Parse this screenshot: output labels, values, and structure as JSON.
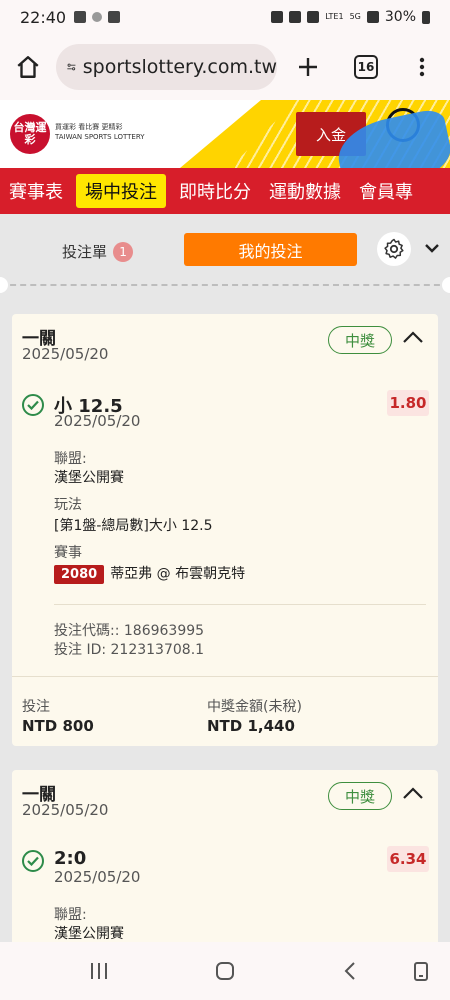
{
  "status_bar": {
    "time": "22:40",
    "network": "LTE1",
    "network_type": "5G",
    "battery": "30%"
  },
  "browser": {
    "url": "sportslottery.com.tw",
    "tab_count": "16"
  },
  "site": {
    "logo_text": "台灣運彩",
    "logo_sub_line1": "買運彩 看比賽 更精彩",
    "logo_sub_line2": "TAIWAN SPORTS LOTTERY",
    "deposit_label": "入金"
  },
  "nav": {
    "items": [
      "賽事表",
      "場中投注",
      "即時比分",
      "運動數據",
      "會員專"
    ],
    "active_index": 1
  },
  "betslip": {
    "slip_label": "投注單",
    "slip_count": "1",
    "my_bets_label": "我的投注"
  },
  "cards": [
    {
      "title": "一關",
      "date": "2025/05/20",
      "status": "中獎",
      "selection": "小 12.5",
      "selection_date": "2025/05/20",
      "odds": "1.80",
      "league_label": "聯盟:",
      "league": "漢堡公開賽",
      "market_label": "玩法",
      "market": "[第1盤-總局數]大小 12.5",
      "event_label": "賽事",
      "event_code": "2080",
      "event": "蒂亞弗 @ 布雲朝克特",
      "bet_code": "投注代碼:: 186963995",
      "bet_id": "投注 ID: 212313708.1",
      "stake_label": "投注",
      "stake": "NTD 800",
      "payout_label": "中獎金額(未稅)",
      "payout": "NTD 1,440"
    },
    {
      "title": "一關",
      "date": "2025/05/20",
      "status": "中獎",
      "selection": "2:0",
      "selection_date": "2025/05/20",
      "odds": "6.34",
      "league_label": "聯盟:",
      "league": "漢堡公開賽"
    }
  ]
}
